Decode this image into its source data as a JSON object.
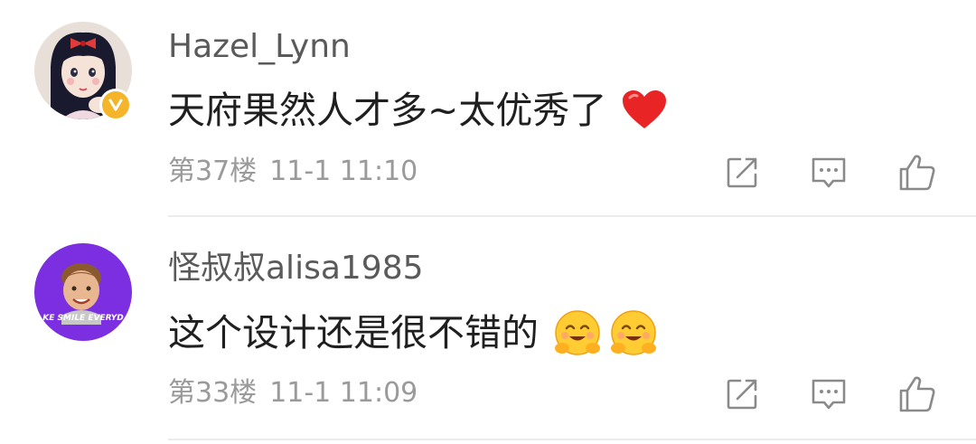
{
  "comments": [
    {
      "username": "Hazel_Lynn",
      "text": "天府果然人才多~太优秀了",
      "emoji": [
        "red-heart-emoji"
      ],
      "floor": "第37楼",
      "time": "11-1 11:10",
      "verified": true,
      "avatar": "girl-illustration-avatar"
    },
    {
      "username": "怪叔叔alisa1985",
      "text": "这个设计还是很不错的",
      "emoji": [
        "hugging-face-emoji",
        "hugging-face-emoji"
      ],
      "floor": "第33楼",
      "time": "11-1 11:09",
      "verified": false,
      "avatar": "boy-photo-avatar",
      "avatar_caption": "KE SMILE EVERYD"
    }
  ],
  "icons": {
    "share": "share-icon",
    "reply": "reply-icon",
    "like": "like-icon"
  },
  "colors": {
    "username": "#5a5a5a",
    "text": "#1f1f1f",
    "meta": "#9a9a9a",
    "divider": "#ececec",
    "verified_badge": "#f5b52a",
    "avatar2_bg": "#7b2fe0"
  }
}
